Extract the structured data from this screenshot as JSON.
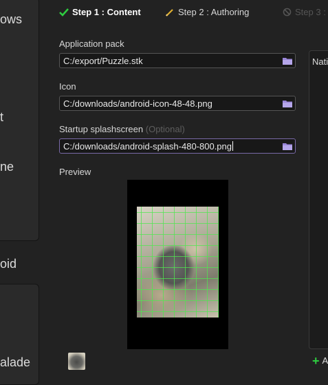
{
  "sidebar": {
    "items": [
      "ows",
      "t",
      "ne",
      "oid",
      "alade"
    ]
  },
  "steps": [
    {
      "label": "Step 1 : Content",
      "state": "done"
    },
    {
      "label": "Step 2 : Authoring",
      "state": "pending"
    },
    {
      "label": "Step 3 :",
      "state": "disabled"
    }
  ],
  "form": {
    "app_pack": {
      "label": "Application pack",
      "value": "C:/export/Puzzle.stk"
    },
    "icon": {
      "label": "Icon",
      "value": "C:/downloads/android-icon-48-48.png"
    },
    "splash": {
      "label": "Startup splashscreen",
      "optional": "(Optional)",
      "value": "C:/downloads/android-splash-480-800.png"
    },
    "preview_label": "Preview"
  },
  "right_panel": {
    "title": "Nati",
    "add_label": "A"
  },
  "colors": {
    "background": "#222222",
    "check": "#2ecc40",
    "grid": "#50e650",
    "active_border": "#7a6aa8"
  }
}
